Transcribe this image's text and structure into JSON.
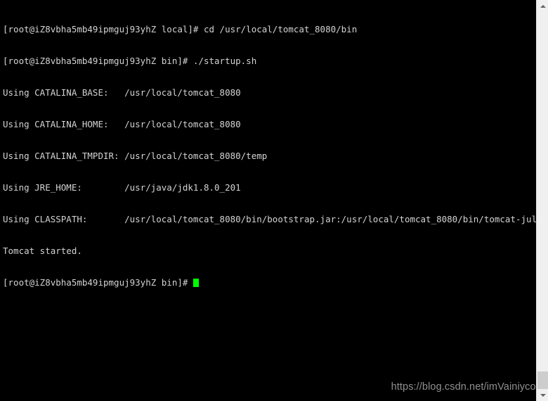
{
  "terminal": {
    "prompt_user_host_local": "[root@iZ8vbha5mb49ipmguj93yhZ local]# ",
    "prompt_user_host_bin": "[root@iZ8vbha5mb49ipmguj93yhZ bin]# ",
    "lines": [
      "[root@iZ8vbha5mb49ipmguj93yhZ local]# cd /usr/local/tomcat_8080/bin",
      "[root@iZ8vbha5mb49ipmguj93yhZ bin]# ./startup.sh",
      "Using CATALINA_BASE:   /usr/local/tomcat_8080",
      "Using CATALINA_HOME:   /usr/local/tomcat_8080",
      "Using CATALINA_TMPDIR: /usr/local/tomcat_8080/temp",
      "Using JRE_HOME:        /usr/java/jdk1.8.0_201",
      "Using CLASSPATH:       /usr/local/tomcat_8080/bin/bootstrap.jar:/usr/local/tomcat_8080/bin/tomcat-juli.jar",
      "Tomcat started.",
      "[root@iZ8vbha5mb49ipmguj93yhZ bin]# "
    ],
    "commands": {
      "cd_command": "cd /usr/local/tomcat_8080/bin",
      "startup_command": "./startup.sh"
    },
    "env_vars": [
      {
        "name": "Using CATALINA_BASE:",
        "value": "/usr/local/tomcat_8080"
      },
      {
        "name": "Using CATALINA_HOME:",
        "value": "/usr/local/tomcat_8080"
      },
      {
        "name": "Using CATALINA_TMPDIR:",
        "value": "/usr/local/tomcat_8080/temp"
      },
      {
        "name": "Using JRE_HOME:",
        "value": "/usr/java/jdk1.8.0_201"
      },
      {
        "name": "Using CLASSPATH:",
        "value": "/usr/local/tomcat_8080/bin/bootstrap.jar:/usr/local/tomcat_8080/bin/tomcat-juli.jar"
      }
    ],
    "status_message": "Tomcat started.",
    "colors": {
      "background": "#000000",
      "foreground": "#d3d3d3",
      "cursor": "#00ff00"
    }
  },
  "watermark": {
    "text": "https://blog.csdn.net/imVainiycos",
    "color": "#8f8f8f"
  },
  "scrollbar": {
    "up_arrow": "scroll-up",
    "down_arrow": "scroll-down",
    "thumb": "scroll-thumb"
  }
}
